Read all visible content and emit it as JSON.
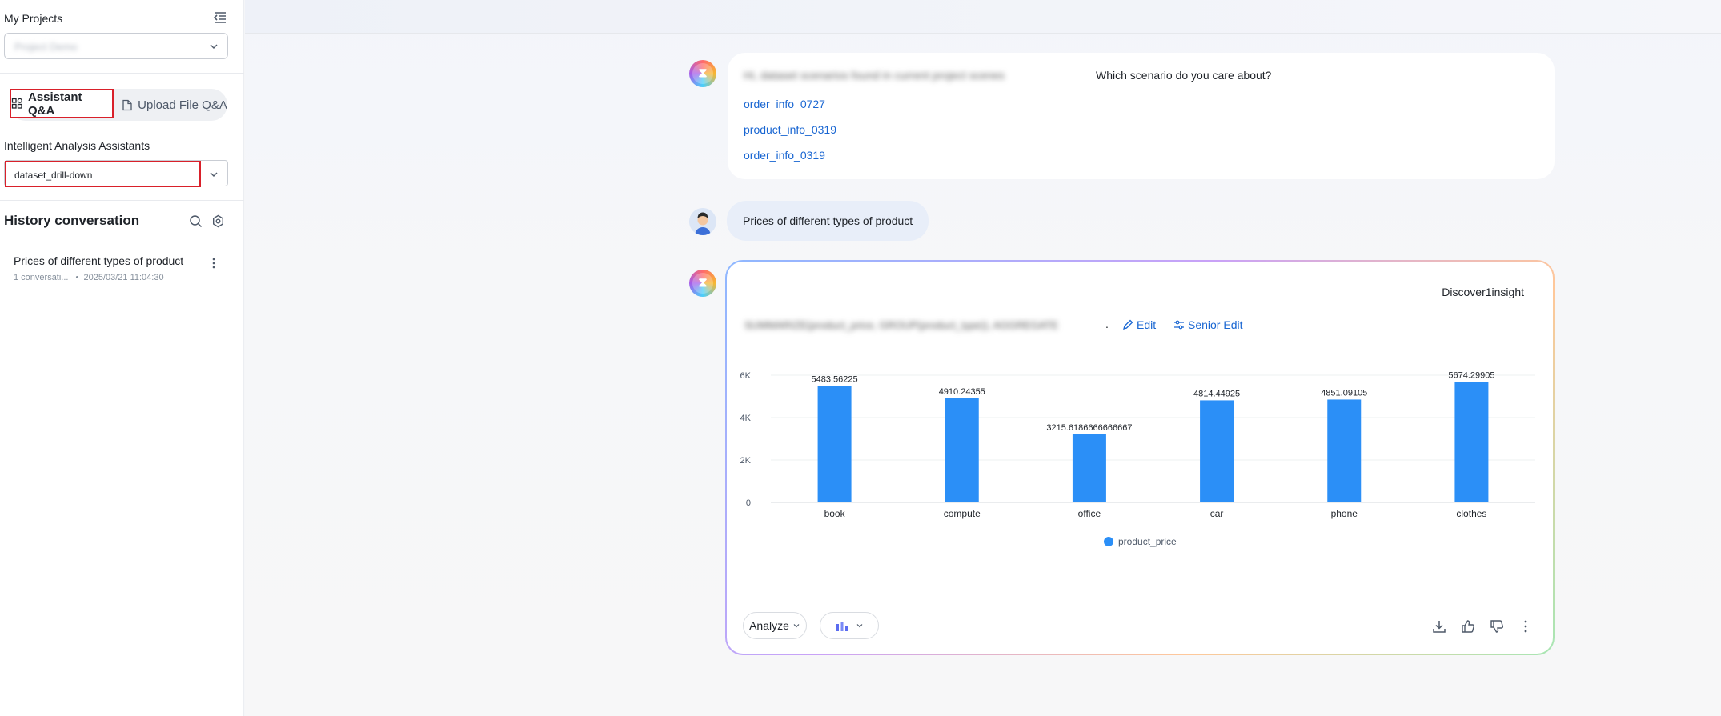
{
  "sidebar": {
    "projects_title": "My Projects",
    "project_select_value": "Project Demo",
    "tabs": [
      {
        "label": "Assistant Q&A"
      },
      {
        "label": "Upload File Q&A"
      }
    ],
    "assistants_label": "Intelligent Analysis Assistants",
    "assistant_select_value": "dataset_drill-down",
    "history_title": "History conversation",
    "history_items": [
      {
        "title": "Prices of different types of product",
        "count": "1 conversati...",
        "bullet": "•",
        "time": "2025/03/21 11:04:30"
      }
    ]
  },
  "chat": {
    "bot_reply_1": {
      "blurred_text": "Hi, dataset scenarios found in current project scenes",
      "question": "Which scenario do you care about?",
      "options": [
        "order_info_0727",
        "product_info_0319",
        "order_info_0319"
      ]
    },
    "user_message": "Prices of different types of product",
    "bot_reply_2": {
      "discover_label": "Discover1insight",
      "blurred_text": "SUMMARIZE(product_price, GROUP(product_type)), AGGREGATE",
      "dot": ".",
      "edit_label": "Edit",
      "senior_edit_label": "Senior Edit",
      "analyze_label": "Analyze"
    }
  },
  "chart_data": {
    "type": "bar",
    "categories": [
      "book",
      "compute",
      "office",
      "car",
      "phone",
      "clothes"
    ],
    "series": [
      {
        "name": "product_price",
        "values": [
          5483.56225,
          4910.24355,
          3215.6186666666667,
          4814.44925,
          4851.09105,
          5674.29905
        ]
      }
    ],
    "data_labels": [
      "5483.56225",
      "4910.24355",
      "3215.6186666666667",
      "4814.44925",
      "4851.09105",
      "5674.29905"
    ],
    "y_ticks": [
      "0",
      "2K",
      "4K",
      "6K"
    ],
    "ylim": [
      0,
      6000
    ],
    "legend_position": "bottom",
    "grid": true,
    "color": "#2b8ff7"
  }
}
